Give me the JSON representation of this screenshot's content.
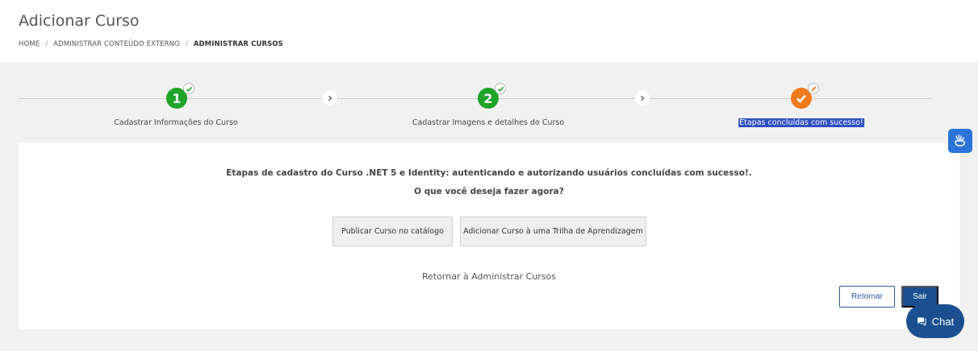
{
  "header": {
    "title": "Adicionar Curso",
    "breadcrumb": [
      "HOME",
      "ADMINISTRAR CONTEÚDO EXTERNO",
      "ADMINISTRAR CURSOS"
    ]
  },
  "stepper": {
    "steps": [
      {
        "number": "1",
        "label": "Cadastrar Informações do Curso",
        "state": "complete",
        "color": "#1fa328",
        "icon": "check-icon"
      },
      {
        "number": "2",
        "label": "Cadastrar Imagens e detalhes do Curso",
        "state": "complete",
        "color": "#1fa328",
        "icon": "check-icon"
      },
      {
        "number": "",
        "label": "Etapas concluídas com sucesso!",
        "state": "current",
        "color": "#f07a1a",
        "icon": "pencil-icon"
      }
    ]
  },
  "content": {
    "message": "Etapas de cadastro do Curso .NET 5 e Identity: autenticando e autorizando usuários concluídas com sucesso!.",
    "question": "O que você deseja fazer agora?",
    "publish_button": "Publicar Curso no catálogo",
    "add_trail_button": "Adicionar Curso à uma Trilha de Aprendizagem",
    "return_link": "Retornar à Administrar Cursos",
    "retornar_button": "Retornar",
    "sair_button": "Sair"
  },
  "chat": {
    "label": "Chat"
  },
  "colors": {
    "primary": "#1b4f8f",
    "success": "#1fa328",
    "warning": "#f07a1a",
    "accessibility": "#2a73d8"
  }
}
